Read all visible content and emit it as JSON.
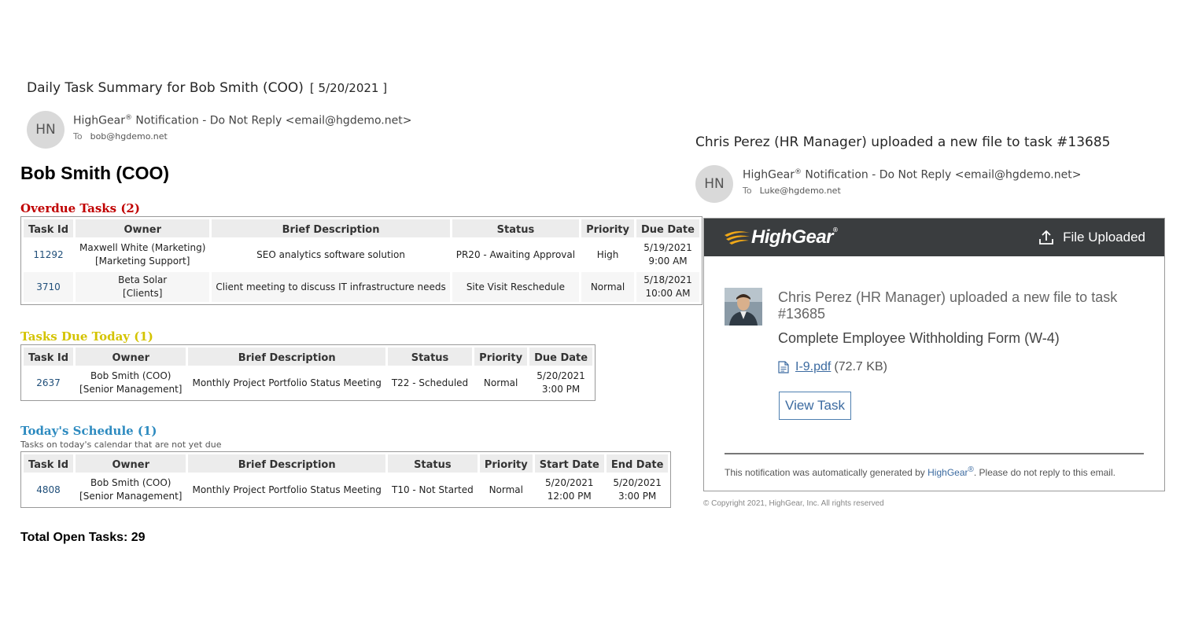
{
  "left_email": {
    "subject": "Daily Task Summary for Bob Smith (COO)",
    "subject_date": "[ 5/20/2021 ]",
    "avatar_initials": "HN",
    "sender_name": "HighGear",
    "registered_mark": "®",
    "sender_rest": " Notification - Do Not Reply <email@hgdemo.net>",
    "to_label": "To",
    "to_address": "bob@hgdemo.net",
    "person_name": "Bob Smith (COO)",
    "overdue": {
      "heading": "Overdue Tasks (2)",
      "color": "#c00000",
      "columns": [
        "Task Id",
        "Owner",
        "Brief Description",
        "Status",
        "Priority",
        "Due Date"
      ],
      "rows": [
        {
          "id": "11292",
          "owner1": "Maxwell White (Marketing)",
          "owner2": "[Marketing Support]",
          "desc": "SEO analytics software solution",
          "status": "PR20 - Awaiting Approval",
          "priority": "High",
          "date1": "5/19/2021",
          "time1": "9:00 AM"
        },
        {
          "id": "3710",
          "owner1": "Beta Solar",
          "owner2": "[Clients]",
          "desc": "Client meeting to discuss IT infrastructure needs",
          "status": "Site Visit Reschedule",
          "priority": "Normal",
          "date1": "5/18/2021",
          "time1": "10:00 AM"
        }
      ]
    },
    "due_today": {
      "heading": "Tasks Due Today (1)",
      "color": "#d4c300",
      "columns": [
        "Task Id",
        "Owner",
        "Brief Description",
        "Status",
        "Priority",
        "Due Date"
      ],
      "rows": [
        {
          "id": "2637",
          "owner1": "Bob Smith (COO)",
          "owner2": "[Senior Management]",
          "desc": "Monthly Project Portfolio Status Meeting",
          "status": "T22 - Scheduled",
          "priority": "Normal",
          "date1": "5/20/2021",
          "time1": "3:00 PM"
        }
      ]
    },
    "schedule": {
      "heading": "Today's Schedule (1)",
      "subheading": "Tasks on today's calendar that are not yet due",
      "color": "#2e8bc0",
      "columns": [
        "Task Id",
        "Owner",
        "Brief Description",
        "Status",
        "Priority",
        "Start Date",
        "End Date"
      ],
      "rows": [
        {
          "id": "4808",
          "owner1": "Bob Smith (COO)",
          "owner2": "[Senior Management]",
          "desc": "Monthly Project Portfolio Status Meeting",
          "status": "T10 - Not Started",
          "priority": "Normal",
          "date1": "5/20/2021",
          "time1": "12:00 PM",
          "date2": "5/20/2021",
          "time2": "3:00 PM"
        }
      ]
    },
    "total_label": "Total Open Tasks: 29"
  },
  "right_email": {
    "subject": "Chris Perez (HR Manager) uploaded a new file to task #13685",
    "avatar_initials": "HN",
    "sender_name": "HighGear",
    "registered_mark": "®",
    "sender_rest": " Notification - Do Not Reply <email@hgdemo.net>",
    "to_label": "To",
    "to_address": "Luke@hgdemo.net",
    "card": {
      "logo_text": "HighGear",
      "logo_mark": "®",
      "bar_label": "File Uploaded",
      "message_line1": "Chris Perez (HR Manager) uploaded a new file to task",
      "message_line2": "#13685",
      "task_name": "Complete Employee Withholding Form (W-4)",
      "file_name": "I-9.pdf",
      "file_size": "(72.7 KB)",
      "button_label": "View Task",
      "footer_prefix": "This notification was automatically generated by ",
      "footer_brand": "HighGear",
      "footer_mark": "®",
      "footer_suffix": ". Please do not reply to this email.",
      "bar_color": "#3a3d3f",
      "accent_color": "#f0a818",
      "link_color": "#3b6aa0"
    },
    "copyright": "© Copyright 2021, HighGear, Inc. All rights reserved"
  }
}
